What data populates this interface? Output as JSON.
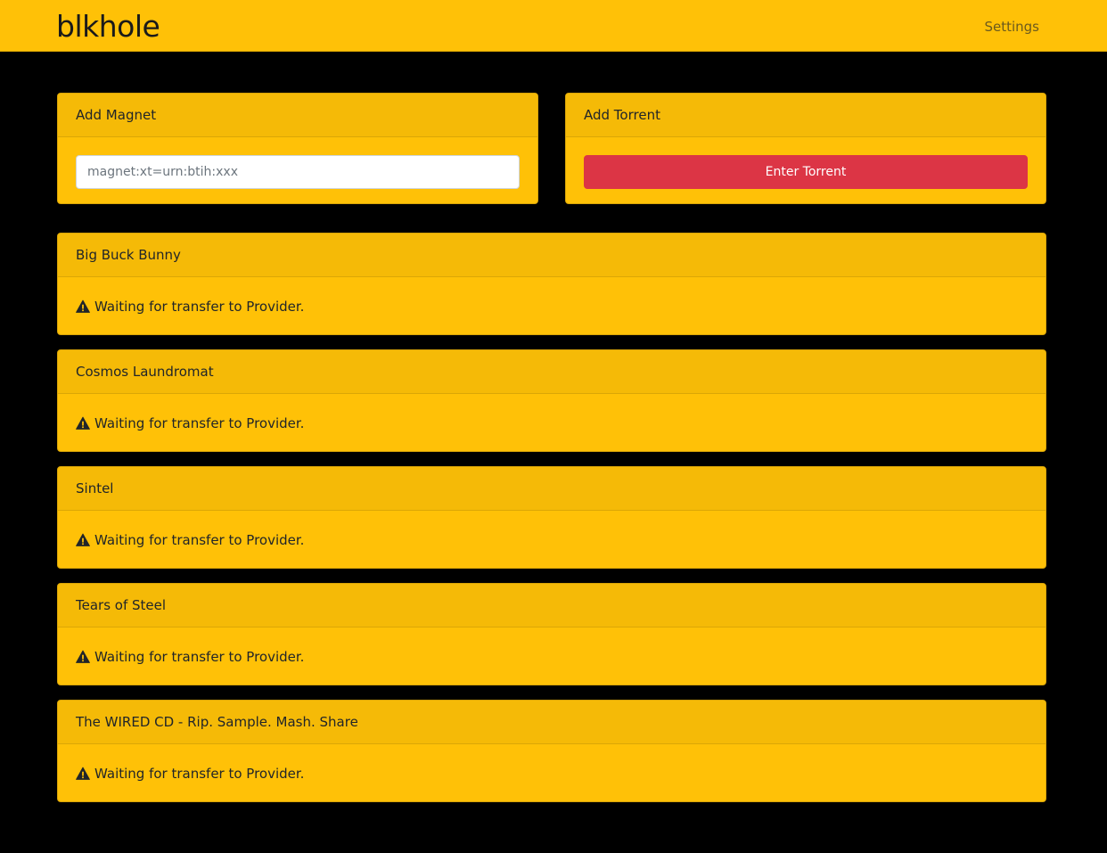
{
  "navbar": {
    "brand": "blkhole",
    "settings_label": "Settings"
  },
  "add_magnet": {
    "title": "Add Magnet",
    "placeholder": "magnet:xt=urn:btih:xxx",
    "value": ""
  },
  "add_torrent": {
    "title": "Add Torrent",
    "button_label": "Enter Torrent"
  },
  "torrents": [
    {
      "name": "Big Buck Bunny",
      "status": "Waiting for transfer to Provider.",
      "status_icon": "warning-icon"
    },
    {
      "name": "Cosmos Laundromat",
      "status": "Waiting for transfer to Provider.",
      "status_icon": "warning-icon"
    },
    {
      "name": "Sintel",
      "status": "Waiting for transfer to Provider.",
      "status_icon": "warning-icon"
    },
    {
      "name": "Tears of Steel",
      "status": "Waiting for transfer to Provider.",
      "status_icon": "warning-icon"
    },
    {
      "name": "The WIRED CD - Rip. Sample. Mash. Share",
      "status": "Waiting for transfer to Provider.",
      "status_icon": "warning-icon"
    }
  ],
  "colors": {
    "background": "#000000",
    "accent": "#ffc107",
    "danger": "#dc3545"
  }
}
